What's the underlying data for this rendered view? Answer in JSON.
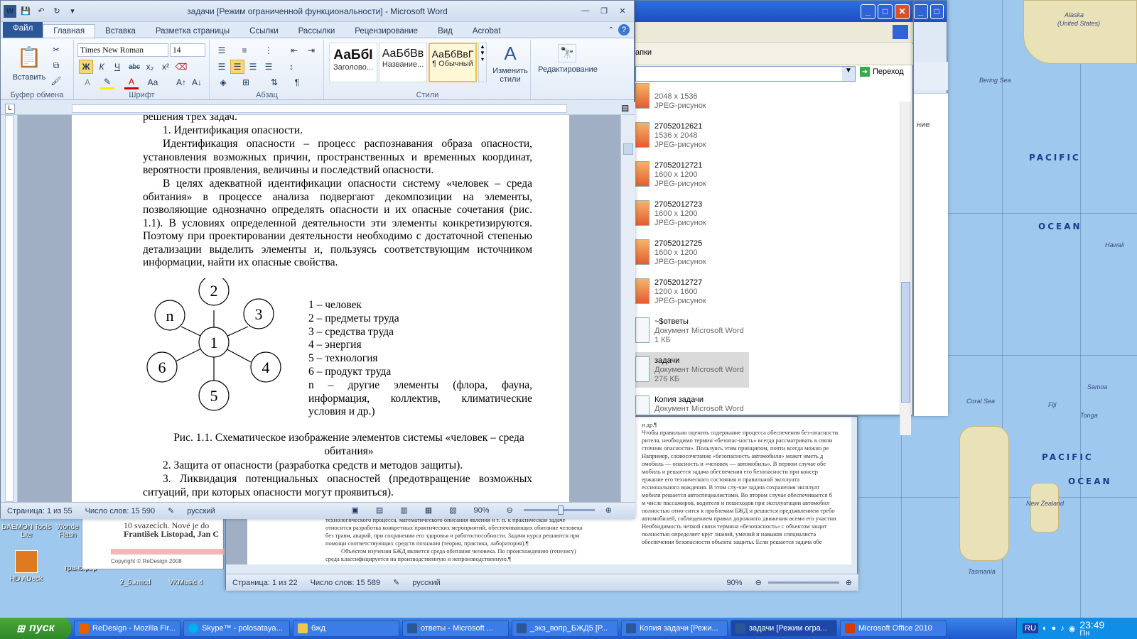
{
  "map": {
    "labels": [
      "PACIFIC",
      "OCEAN",
      "PACIFIC",
      "OCEAN"
    ],
    "small_labels": [
      "Alaska",
      "(United States)",
      "Bering Sea",
      "Hawaii",
      "New Zealand",
      "Tonga",
      "Fiji",
      "Samoa",
      "Coral Sea",
      "Tasmania"
    ]
  },
  "desktop_icons": [
    {
      "label": "DAEMON Tools Lite"
    },
    {
      "label": "Wonde Flash"
    },
    {
      "label": "HD ADeck"
    },
    {
      "label": "трансфер"
    },
    {
      "label": "2_5.xmcd"
    },
    {
      "label": "VKMusic 4"
    }
  ],
  "word": {
    "title": "задачи [Режим ограниченной функциональности]  -  Microsoft Word",
    "tabs": [
      "Файл",
      "Главная",
      "Вставка",
      "Разметка страницы",
      "Ссылки",
      "Рассылки",
      "Рецензирование",
      "Вид",
      "Acrobat"
    ],
    "font_name": "Times New Roman",
    "font_size": "14",
    "groups": {
      "clipboard": "Буфер обмена",
      "font": "Шрифт",
      "paragraph": "Абзац",
      "styles": "Стили"
    },
    "paste_label": "Вставить",
    "styles": [
      {
        "preview": "АаБбІ",
        "name": "Заголово..."
      },
      {
        "preview": "АаБбВв",
        "name": "Название..."
      },
      {
        "preview": "АаБбВвГ",
        "name": "¶ Обычный"
      }
    ],
    "change_styles": "Изменить стили",
    "editing": "Редактирование",
    "doc": {
      "p0": "решения трех задач.",
      "p1": "1. Идентификация опасности.",
      "p2": "Идентификация опасности – процесс распознавания образа опасности, установления возможных причин, пространственных и временных координат, вероятности проявления, величины и последствий опасности.",
      "p3": "В целях адекватной идентификации опасности систему «человек – среда обитания» в процессе анализа подвергают декомпозиции на элементы, позволяющие однозначно определять опасности и их опасные сочетания (рис. 1.1). В условиях определенной деятельности эти элементы конкретизируются. Поэтому при проектировании деятельности необходимо с достаточной степенью детализации выделить элементы и, пользуясь соответствующим источником информации, найти их опасные свойства.",
      "legend": [
        "1 – человек",
        "2 – предметы труда",
        "3 – средства труда",
        "4 – энергия",
        "5 – технология",
        "6 – продукт труда",
        "n – другие элементы (флора, фауна, информация, коллектив, климатические условия и др.)"
      ],
      "diagram_nodes": [
        "1",
        "2",
        "3",
        "4",
        "5",
        "6",
        "n"
      ],
      "caption": "Рис. 1.1. Схематическое изображение элементов системы «человек – среда обитания»",
      "p4": "2. Защита от опасности (разработка средств и методов защиты).",
      "p5": "3. Ликвидация потенциальных опасностей (предотвращение возможных ситуаций, при которых опасности могут проявиться)."
    },
    "status": {
      "page": "Страница: 1 из 55",
      "words": "Число слов: 15 590",
      "lang": "русский",
      "zoom": "90%"
    }
  },
  "explorer": {
    "toolbar_text": "апки",
    "go_label": "Переход",
    "files": [
      {
        "name": "",
        "size": "2048 x 1536",
        "type": "JPEG-рисунок"
      },
      {
        "name": "27052012621",
        "size": "1536 x 2048",
        "type": "JPEG-рисунок"
      },
      {
        "name": "27052012721",
        "size": "1600 x 1200",
        "type": "JPEG-рисунок"
      },
      {
        "name": "27052012723",
        "size": "1600 x 1200",
        "type": "JPEG-рисунок"
      },
      {
        "name": "27052012725",
        "size": "1600 x 1200",
        "type": "JPEG-рисунок"
      },
      {
        "name": "27052012727",
        "size": "1200 x 1600",
        "type": "JPEG-рисунок"
      },
      {
        "name": "~$ответы",
        "size": "Документ Microsoft Word",
        "type": "1 КБ"
      },
      {
        "name": "задачи",
        "size": "Документ Microsoft Word",
        "type": "276 КБ"
      },
      {
        "name": "Копия задачи",
        "size": "Документ Microsoft Word",
        "type": "276 КБ"
      }
    ]
  },
  "browser_partial": {
    "text": "ние"
  },
  "word2": {
    "lines": [
      "технологического процесса, математического описания явления и т. п. к практической задаче",
      "относится разработка конкретных практических мероприятий, обеспечивающих обитание человека",
      "без травм, аварий, при сохранении его здоровья и работоспособности. Задачи курса решаются при",
      "помощи соответствующих средств познания (теория, практика, лаборатория).¶",
      "Объектом изучения БЖД является среда обитания человека. По происхождению (генезису)",
      "среда классифицируется на производственную и непроизводственную.¶"
    ],
    "right_lines": [
      "и др.¶",
      "Чтобы правильно оценить содержание процесса обеспечения без-опасности",
      "рителя, необходимо термин «безопас-ность» всегда рассматривать в связи",
      "сточник опасности». Пользуясь этим принципом, почти всегда можно ре",
      "Например, словосочетание «безопасность автомобиля» может иметь д",
      "омобиль — опасность и «человек — автомобиль». В первом случае обе",
      "мобиль и решается задача обеспечения его безопасности при консер",
      "ержание его технического состояния и правильной эксплуата",
      "ессионального вождения. В этом слу-чае задача сохранения эксплуат",
      "мобиля решается автоспециалистами. Во втором случае обеспечивается б",
      "м числе пассажиров, водителя и пешеходов при эксплуатации автомобил",
      "полностью отно-сится к проблемам БЖД и решается предъявлением требо",
      "автомобилей, соблюдением правил дорожного движения всеми его участни",
      "Необходимость четкой связи термина «безопасность» с объектом защит",
      "полностью определяет круг знаний, умений и навыков специалиста",
      "обеспечения безопасности объекта защиты. Если решается задача обе"
    ],
    "status": {
      "page": "Страница: 1 из 22",
      "words": "Число слов: 15 589",
      "lang": "русский",
      "zoom": "90%"
    }
  },
  "redesign": {
    "line1": "10 svazecích. Nové je do",
    "line2": "František Listopad, Jan C",
    "copyright": "Copyright © ReDesign 2008"
  },
  "taskbar": {
    "start": "пуск",
    "items": [
      "ReDesign - Mozilla Fir...",
      "Skype™ - polosataya...",
      "бжд",
      "ответы - Microsoft ...",
      "_экз_вопр_БЖД5 [Р...",
      "Копия задачи [Режи...",
      "задачи [Режим огра...",
      "Microsoft Office 2010"
    ],
    "lang": "RU",
    "time": "23:49",
    "day": "Пн"
  }
}
